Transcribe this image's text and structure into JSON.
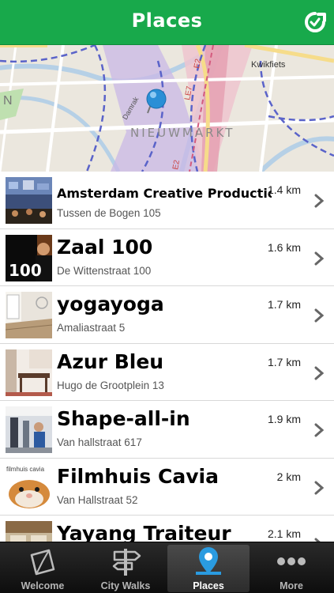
{
  "header": {
    "title": "Places",
    "refresh_icon": "refresh-icon"
  },
  "map": {
    "labels": [
      "Kwikfiets",
      "NIEUWMARKT",
      "Damrak",
      "LE7",
      "E2",
      "E2",
      "N"
    ],
    "pin_icon": "location-pin-icon"
  },
  "places": [
    {
      "name": "Amsterdam Creative Productions",
      "address": "Tussen de Bogen 105",
      "distance": "1.4 km"
    },
    {
      "name": "Zaal 100",
      "address": "De Wittenstraat 100",
      "distance": "1.6 km"
    },
    {
      "name": "yogayoga",
      "address": "Amaliastraat 5",
      "distance": "1.7 km"
    },
    {
      "name": "Azur Bleu",
      "address": "Hugo de Grootplein 13",
      "distance": "1.7 km"
    },
    {
      "name": "Shape-all-in",
      "address": "Van hallstraat 617",
      "distance": "1.9 km"
    },
    {
      "name": "Filmhuis Cavia",
      "address": "Van Hallstraat 52",
      "distance": "2 km"
    },
    {
      "name": "Yayang Traiteur",
      "address": "",
      "distance": "2.1 km"
    }
  ],
  "thumb_text": {
    "zaal": "100",
    "cavia": "filmhuis cavia"
  },
  "tabs": [
    {
      "label": "Welcome",
      "icon": "welcome-icon"
    },
    {
      "label": "City Walks",
      "icon": "signpost-icon"
    },
    {
      "label": "Places",
      "icon": "map-pin-icon",
      "active": true
    },
    {
      "label": "More",
      "icon": "more-icon"
    }
  ],
  "colors": {
    "brand_green": "#18a94b",
    "tab_bar": "#1a1a1a",
    "pin_blue": "#2a8fd6"
  }
}
